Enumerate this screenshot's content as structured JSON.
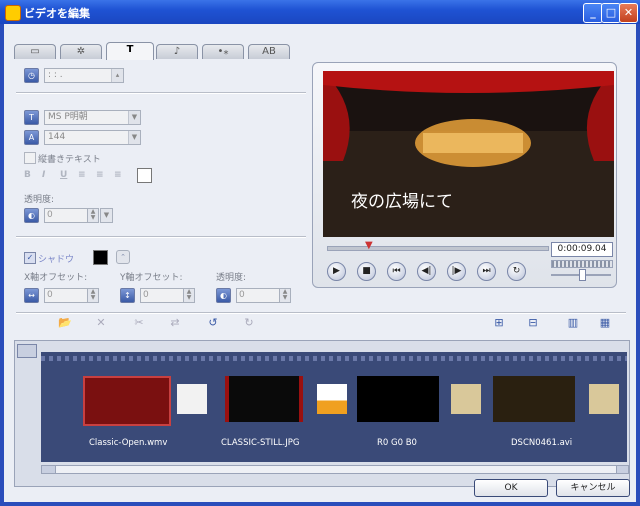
{
  "window": {
    "title": "ビデオを編集"
  },
  "tabs": [
    {
      "icon": "film-icon",
      "glyph": "▭"
    },
    {
      "icon": "reel-icon",
      "glyph": "✲"
    },
    {
      "icon": "text-icon",
      "glyph": "T"
    },
    {
      "icon": "music-icon",
      "glyph": "♪"
    },
    {
      "icon": "effects-icon",
      "glyph": "•⁎"
    },
    {
      "icon": "ab-transition-icon",
      "glyph": "AB"
    }
  ],
  "title_panel": {
    "time_value": ":  :  .",
    "font_name": "MS P明朝",
    "font_size": "144",
    "vertical_text_label": "縦書きテキスト",
    "format_glyphs": [
      "B",
      "I",
      "U",
      "≡",
      "≡",
      "≡"
    ],
    "transparency_label": "透明度:",
    "transparency_value": "0",
    "shadow_label": "シャドウ",
    "x_offset_label": "X軸オフセット:",
    "y_offset_label": "Y軸オフセット:",
    "shadow_transparency_label": "透明度:",
    "x_offset_value": "0",
    "y_offset_value": "0",
    "shadow_transparency_value": "0"
  },
  "preview": {
    "caption": "夜の広場にて",
    "timecode": "0:00:09.04"
  },
  "timeline": {
    "clips": [
      {
        "label": "Classic-Open.wmv"
      },
      {
        "label": "CLASSIC-STILL.JPG"
      },
      {
        "label": "R0 G0 B0"
      },
      {
        "label": "DSCN0461.avi"
      }
    ]
  },
  "buttons": {
    "ok": "OK",
    "cancel": "キャンセル"
  },
  "colors": {
    "accent": "#2a4dbb",
    "panel": "#ebeef5",
    "track": "#3a4a78"
  }
}
